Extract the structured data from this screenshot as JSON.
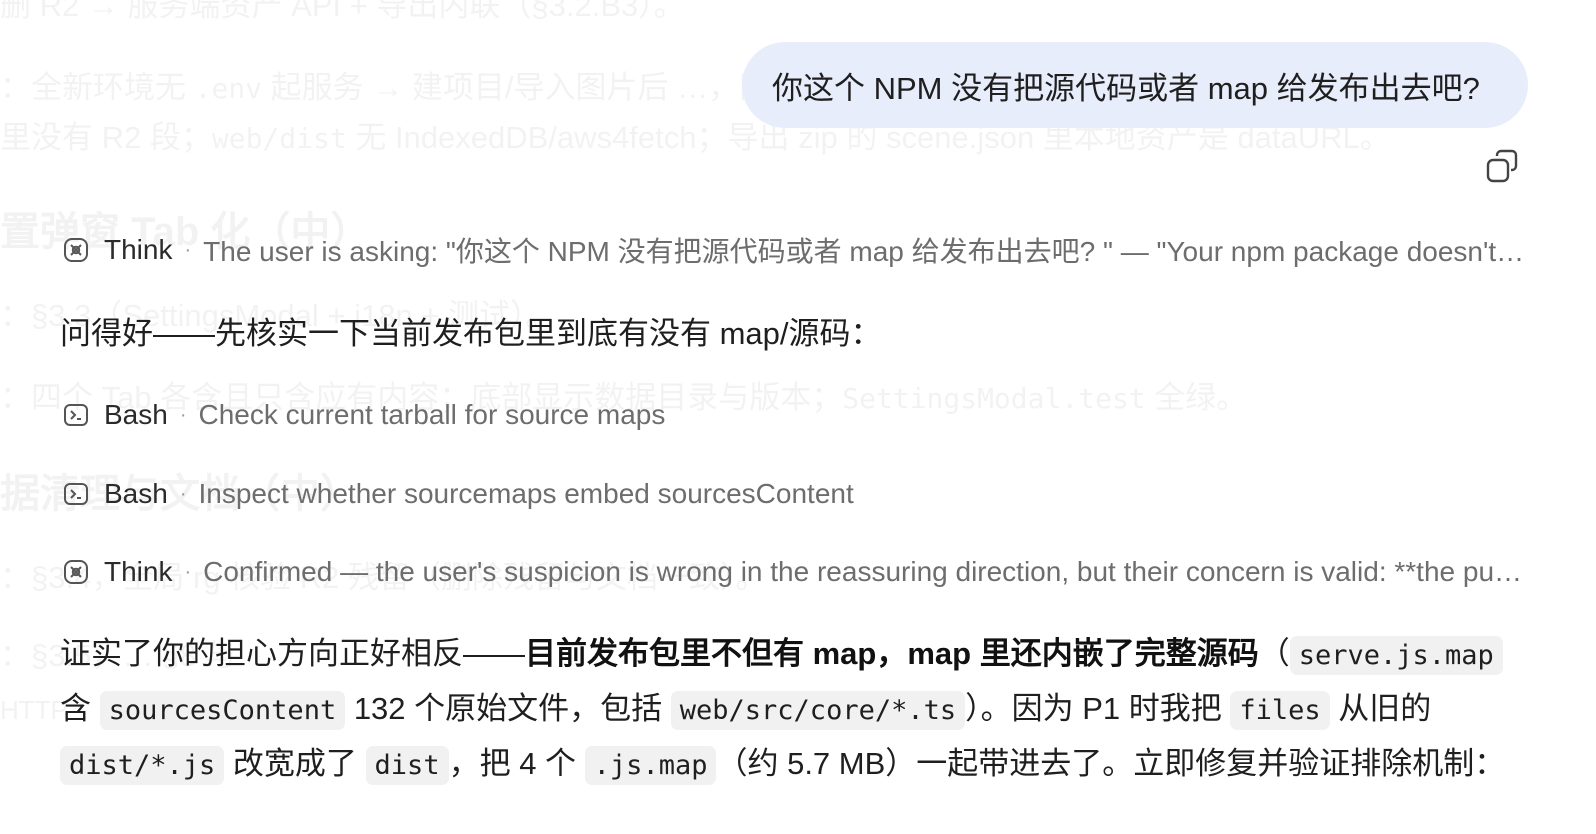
{
  "background": {
    "lines": [
      {
        "text": "删 R2 → 服务端资产 API + 导出内联（§3.2.B3）。"
      },
      {
        "text": "：全新环境无 ",
        "code": ".env",
        "after": " 起服务 → 建项目/导入图片后 …，网络面板无任何对应"
      },
      {
        "text": "里没有 R2 段；",
        "code": "web/dist",
        "after": " 无 IndexedDB/aws4fetch；导出 zip 的 scene.json 里本地资产是 dataURL。"
      },
      {
        "text": "置弹窗 Tab 化（中）"
      },
      {
        "text": "：§3.3（SettingsModal + i18n + 测试）。"
      },
      {
        "text": "：四个 Tab 各含且只含应有内容；底部显示数据目录与版本；",
        "code": "SettingsModal.test",
        "after": " 全绿。"
      },
      {
        "text": "据清理与文档（中）"
      },
      {
        "text": "：§3.4，全局 rg 核验 R2 残留（删除残留与文档一致）。"
      },
      {
        "text": "：§3.5，",
        "after": "…                                                                                                  §8 与"
      },
      {
        "text": "HTTP"
      }
    ]
  },
  "user_message": {
    "text": "你这个 NPM 没有把源代码或者 map 给发布出去吧?"
  },
  "icons": {
    "copy": "copy-icon",
    "think": "think-icon",
    "bash": "terminal-icon"
  },
  "activities": [
    {
      "kind": "Think",
      "icon": "think-icon",
      "desc": "The user is asking: \"你这个 NPM 没有把源代码或者 map 给发布出去吧? \" — \"Your npm package doesn't publish source code or maps, right?\""
    },
    {
      "kind": "Bash",
      "icon": "terminal-icon",
      "desc": "Check current tarball for source maps"
    },
    {
      "kind": "Bash",
      "icon": "terminal-icon",
      "desc": "Inspect whether sourcemaps embed sourcesContent"
    },
    {
      "kind": "Think",
      "icon": "think-icon",
      "desc": "Confirmed — the user's suspicion is wrong in the reassuring direction, but their concern is valid: **the published tarball includes source maps with full sourcesContent**"
    }
  ],
  "intro": "问得好——先核实一下当前发布包里到底有没有 map/源码：",
  "answer": {
    "l1_a": "证实了你的担心方向正好相反——",
    "l1_bold": "目前发布包里不但有 map，map 里还内嵌了完整源码",
    "l1_b": "（",
    "code_serve_map": "serve.js.map",
    "l2_a": "含 ",
    "code_sources_content": "sourcesContent",
    "l2_b": " 132 个原始文件，包括 ",
    "code_web_src": "web/src/core/*.ts",
    "l2_c": "）。因为 P1 时我把 ",
    "code_files": "files",
    "l2_d": " 从旧的",
    "code_dist_js": "dist/*.js",
    "l3_a": " 改宽成了 ",
    "code_dist": "dist",
    "l3_b": "，把 4 个 ",
    "code_js_map": ".js.map",
    "l3_c": "（约 5.7 MB）一起带进去了。立即修复并验证排除机制："
  }
}
